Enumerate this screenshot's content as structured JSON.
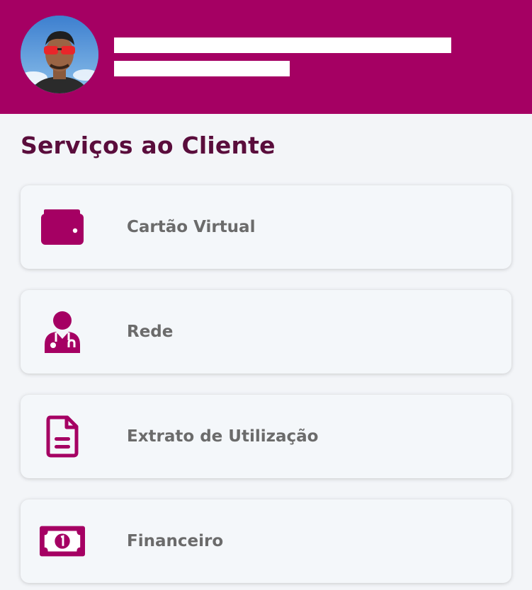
{
  "header": {
    "brand_color": "#a50063",
    "avatar_icon": "user-photo"
  },
  "section": {
    "title": "Serviços ao Cliente"
  },
  "services": [
    {
      "label": "Cartão Virtual",
      "icon": "wallet-icon"
    },
    {
      "label": "Rede",
      "icon": "doctor-icon"
    },
    {
      "label": "Extrato de Utilização",
      "icon": "document-icon"
    },
    {
      "label": "Financeiro",
      "icon": "banknote-icon"
    }
  ],
  "colors": {
    "accent": "#a50063",
    "title": "#5a0d3c",
    "label": "#6b6b6b",
    "background": "#f3f5f8"
  }
}
